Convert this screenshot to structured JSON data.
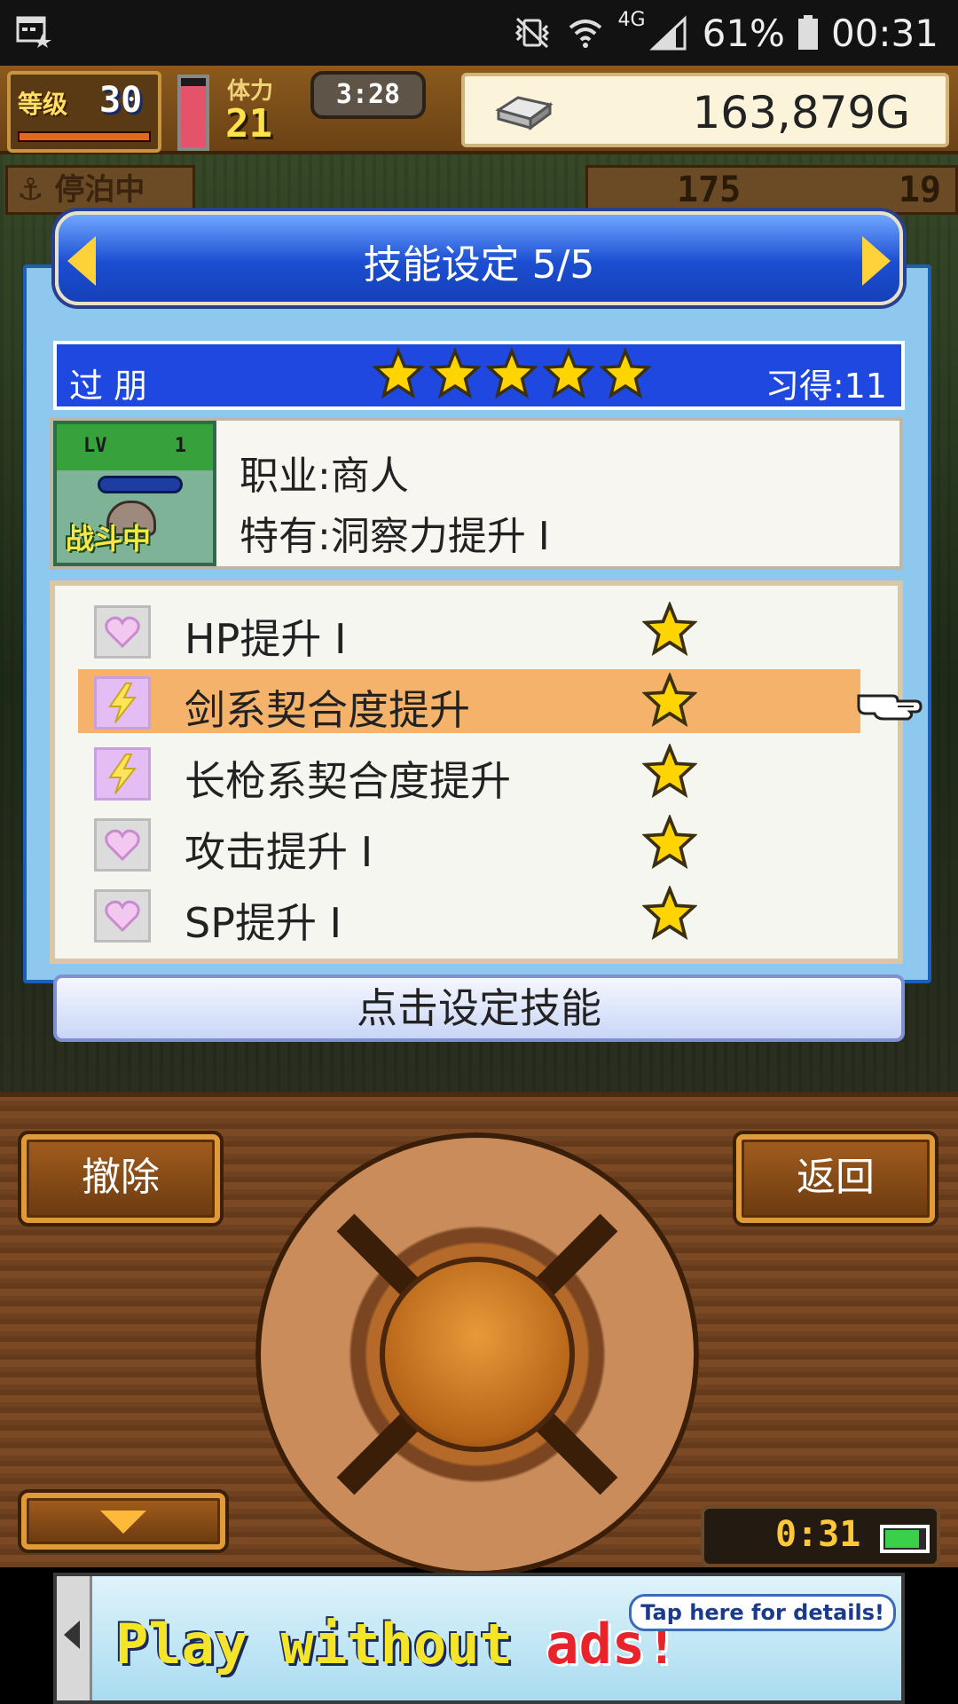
{
  "status_bar": {
    "battery_percent": "61%",
    "time": "00:31",
    "network": "4G"
  },
  "hud": {
    "level_label": "等级",
    "level_value": "30",
    "stamina_label": "体力",
    "stamina_value": "21",
    "timer": "3:28",
    "gold": "163,879G",
    "anchor_label": "停泊中",
    "resource_1": "175",
    "resource_2": "19"
  },
  "dialog": {
    "title": "技能设定 5/5",
    "character_name": "过 朋",
    "star_count": 5,
    "learned": "习得:11",
    "portrait_lv": "LV",
    "portrait_lv_num": "1",
    "portrait_status": "战斗中",
    "job": "职业:商人",
    "special": "特有:洞察力提升 I",
    "skills": [
      {
        "name": "HP提升 I",
        "icon": "heart-icon",
        "stars": 1,
        "selected": false
      },
      {
        "name": "剑系契合度提升",
        "icon": "lightning-icon",
        "stars": 1,
        "selected": true
      },
      {
        "name": "长枪系契合度提升",
        "icon": "lightning-icon",
        "stars": 1,
        "selected": false
      },
      {
        "name": "攻击提升 I",
        "icon": "heart-icon",
        "stars": 1,
        "selected": false
      },
      {
        "name": "SP提升 I",
        "icon": "heart-icon",
        "stars": 1,
        "selected": false
      }
    ],
    "confirm_label": "点击设定技能"
  },
  "controls": {
    "remove_label": "撤除",
    "back_label": "返回",
    "clock": "0:31"
  },
  "ad": {
    "text_main": "Play without ",
    "text_red": "ads!",
    "tip": "Tap here for details!"
  },
  "colors": {
    "dialog_header": "#1b4ed1",
    "selected_row": "#f4b26b",
    "star": "#ffd400",
    "gold_box": "#fbf3da"
  }
}
